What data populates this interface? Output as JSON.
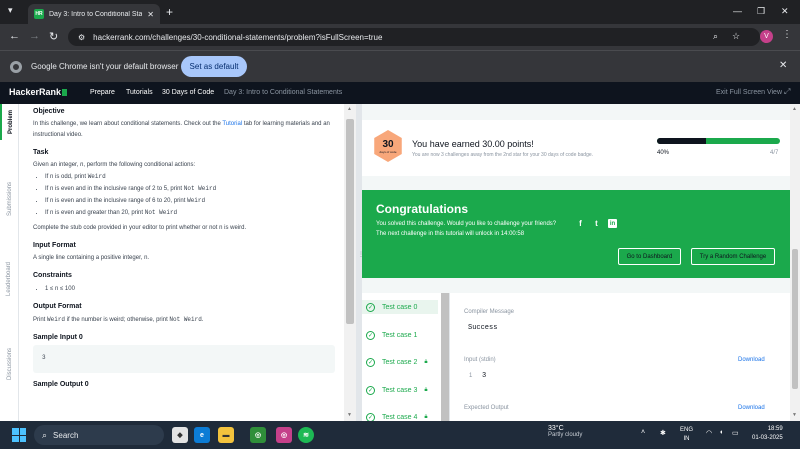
{
  "browser": {
    "tab_title": "Day 3: Intro to Conditional State",
    "tab_favicon": "HR",
    "url": "hackerrank.com/challenges/30-conditional-statements/problem?isFullScreen=true",
    "profile_initial": "V"
  },
  "infobar": {
    "message": "Google Chrome isn't your default browser",
    "button": "Set as default"
  },
  "hr_nav": {
    "logo": "HackerRank",
    "links": [
      "Prepare",
      "Tutorials",
      "30 Days of Code"
    ],
    "crumb": "Day 3: Intro to Conditional Statements",
    "exit": "Exit Full Screen View"
  },
  "side_tabs": [
    "Problem",
    "Submissions",
    "Leaderboard",
    "Discussions"
  ],
  "problem": {
    "objective_h": "Objective",
    "objective_1": "In this challenge, we learn about conditional statements. Check out the",
    "objective_link": "Tutorial",
    "objective_2": "tab for learning materials and an instructional video.",
    "task_h": "Task",
    "task_intro_1": "Given an integer,",
    "task_intro_n": "n",
    "task_intro_2": ", perform the following conditional actions:",
    "rules": [
      {
        "pre": "If n is odd, print",
        "code": "Weird"
      },
      {
        "pre": "If n is even and in the inclusive range of 2 to 5, print",
        "code": "Not Weird"
      },
      {
        "pre": "If n is even and in the inclusive range of 6 to 20, print",
        "code": "Weird"
      },
      {
        "pre": "If n is even and greater than 20, print",
        "code": "Not Weird"
      }
    ],
    "complete": "Complete the stub code provided in your editor to print whether or not n is weird.",
    "input_h": "Input Format",
    "input_t": "A single line containing a positive integer, n.",
    "constraints_h": "Constraints",
    "constraint": "1 ≤ n ≤ 100",
    "output_h": "Output Format",
    "output_1": "Print",
    "output_c1": "Weird",
    "output_2": "if the number is weird; otherwise, print",
    "output_c2": "Not Weird",
    "sample_in_h": "Sample Input 0",
    "sample_in": "3",
    "sample_out_h": "Sample Output 0"
  },
  "points": {
    "badge_number": "30",
    "badge_sub": "days of code",
    "earned": "You have earned 30.00 points!",
    "sub": "You are now 3 challenges away from the 2nd star for your 30 days of code badge.",
    "progress_fraction": 0.4,
    "progress_label": "40%",
    "progress_count": "4/7"
  },
  "congrats": {
    "title": "Congratulations",
    "line1": "You solved this challenge. Would you like to challenge your friends?",
    "line2": "The next challenge in this tutorial will unlock in 14:00:58",
    "btn_dashboard": "Go to Dashboard",
    "btn_random": "Try a Random Challenge"
  },
  "tests": {
    "items": [
      "Test case 0",
      "Test case 1",
      "Test case 2",
      "Test case 3",
      "Test case 4"
    ],
    "compiler_label": "Compiler Message",
    "compiler_value": "Success",
    "input_label": "Input (stdin)",
    "input_line_no": "1",
    "input_value": "3",
    "download": "Download",
    "expected_label": "Expected Output"
  },
  "taskbar": {
    "search": "Search",
    "temp": "33°C",
    "condition": "Partly cloudy",
    "lang_1": "ENG",
    "lang_2": "IN",
    "time": "18:59",
    "date": "01-03-2025"
  },
  "colors": {
    "accent": "#1ba94c",
    "hr_dark": "#0e141e",
    "link": "#1a73e8"
  }
}
